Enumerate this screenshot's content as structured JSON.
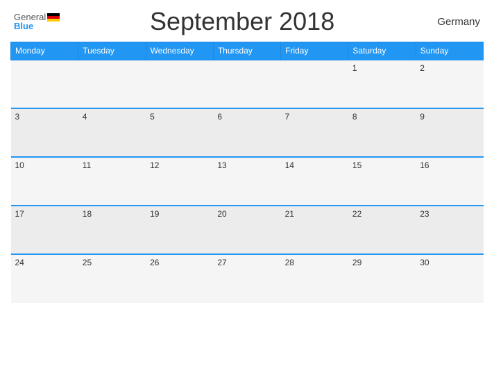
{
  "header": {
    "title": "September 2018",
    "country": "Germany",
    "logo_general": "General",
    "logo_blue": "Blue"
  },
  "days_of_week": [
    "Monday",
    "Tuesday",
    "Wednesday",
    "Thursday",
    "Friday",
    "Saturday",
    "Sunday"
  ],
  "weeks": [
    [
      "",
      "",
      "",
      "",
      "",
      "1",
      "2"
    ],
    [
      "3",
      "4",
      "5",
      "6",
      "7",
      "8",
      "9"
    ],
    [
      "10",
      "11",
      "12",
      "13",
      "14",
      "15",
      "16"
    ],
    [
      "17",
      "18",
      "19",
      "20",
      "21",
      "22",
      "23"
    ],
    [
      "24",
      "25",
      "26",
      "27",
      "28",
      "29",
      "30"
    ]
  ]
}
